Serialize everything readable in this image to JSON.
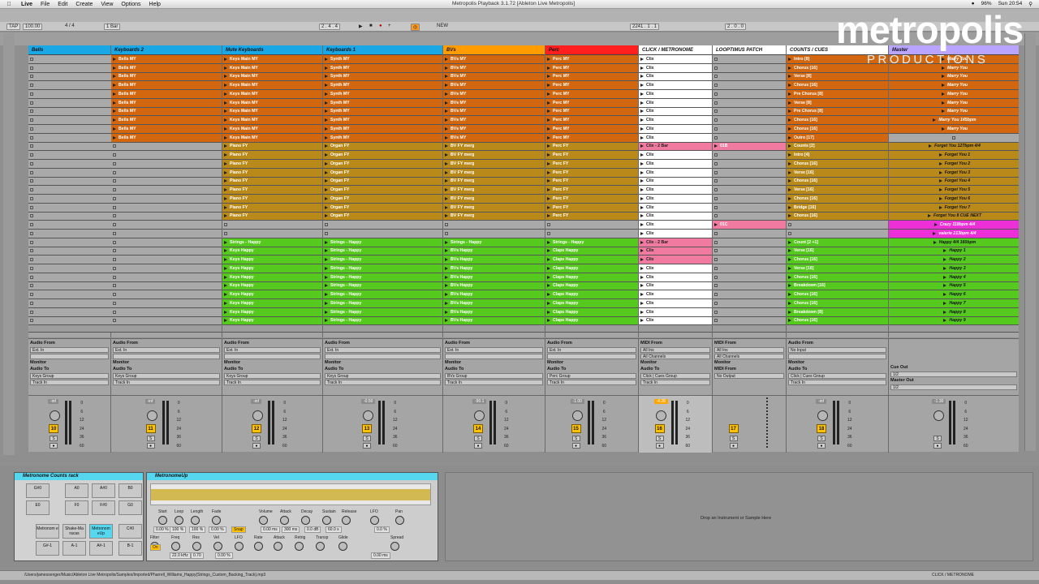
{
  "menubar": {
    "apple": "",
    "items": [
      "Live",
      "File",
      "Edit",
      "Create",
      "View",
      "Options",
      "Help"
    ],
    "title": "Metropolis Playback 3.1.72 [Ableton Live Metropolis]",
    "battery": "96%",
    "clock": "Sun 20:54"
  },
  "transport": {
    "tap": "TAP",
    "tempo": "100.00",
    "sig": "4 / 4",
    "quant": "1 Bar",
    "pos": "2 . 4 . 4",
    "new": "NEW",
    "pos2": "2241 . 1 . 1",
    "end": "2 . 0 . 0"
  },
  "logo": {
    "line1": "metropolis",
    "line2": "PRODUCTIONS"
  },
  "tracks": [
    {
      "name": "Bells",
      "color": "#1aa7e6"
    },
    {
      "name": "Keyboards 2",
      "color": "#1aa7e6"
    },
    {
      "name": "Mute Keyboards",
      "color": "#1aa7e6"
    },
    {
      "name": "Keyboards 1",
      "color": "#1aa7e6"
    },
    {
      "name": "BVs",
      "color": "#ff9d00"
    },
    {
      "name": "Perc",
      "color": "#ff1f1f"
    },
    {
      "name": "CLICK / METRONOME",
      "color": "#ffffff"
    },
    {
      "name": "LOOPTIMUS PATCH",
      "color": "#ffffff"
    },
    {
      "name": "COUNTS / CUES",
      "color": "#ffffff"
    },
    {
      "name": "Master",
      "color": "#b9a5ff"
    }
  ],
  "clips": {
    "bells": [
      "Bells MY",
      "Bells MY",
      "Bells MY",
      "Bells MY",
      "Bells MY",
      "Bells MY",
      "Bells MY",
      "Bells MY",
      "Bells MY",
      "Bells MY"
    ],
    "keys": [
      "Keys Main MY",
      "Keys Main MY",
      "Keys Main MY",
      "Keys Main MY",
      "Keys Main MY",
      "Keys Main MY",
      "Keys Main MY",
      "Keys Main MY",
      "Keys Main MY",
      "Keys Main MY"
    ],
    "piano": [
      "Piano FY",
      "Piano FY",
      "Piano FY",
      "Piano FY",
      "Piano FY",
      "Piano FY",
      "Piano FY",
      "Piano FY",
      "Piano FY"
    ],
    "synth": [
      "Synth MY",
      "Synth MY",
      "Synth MY",
      "Synth MY",
      "Synth MY",
      "Synth MY",
      "Synth MY",
      "Synth MY",
      "Synth MY",
      "Synth MY"
    ],
    "organ": [
      "Organ FY",
      "Organ FY",
      "Organ FY",
      "Organ FY",
      "Organ FY",
      "Organ FY",
      "Organ FY",
      "Organ FY",
      "Organ FY"
    ],
    "bvs": [
      "BVs MY",
      "BVs MY",
      "BVs MY",
      "BVs MY",
      "BVs MY",
      "BVs MY",
      "BVs MY",
      "BVs MY",
      "BVs MY",
      "BVs MY"
    ],
    "bvfy": [
      "BV FY merg",
      "BV FY merg",
      "BV FY merg",
      "BV FY merg",
      "BV FY merg",
      "BV FY merg",
      "BV FY merg",
      "BV FY merg",
      "BV FY merg"
    ],
    "perc": [
      "Perc MY",
      "Perc MY",
      "Perc MY",
      "Perc MY",
      "Perc MY",
      "Perc MY",
      "Perc MY",
      "Perc MY",
      "Perc MY",
      "Perc MY"
    ],
    "percfy": [
      "Perc FY",
      "Perc FY",
      "Perc FY",
      "Perc FY",
      "Perc FY",
      "Perc FY",
      "Perc FY",
      "Perc FY",
      "Perc FY"
    ],
    "happy_mute": [
      "Strings - Happy",
      "Keys Happy",
      "Keys Happy",
      "Keys Happy",
      "Keys Happy",
      "Keys Happy",
      "Keys Happy",
      "Keys Happy",
      "Keys Happy",
      "Keys Happy"
    ],
    "happy_k1": [
      "Strings - Happy",
      "Strings - Happy",
      "Strings - Happy",
      "Strings - Happy",
      "Strings - Happy",
      "Strings - Happy",
      "Strings - Happy",
      "Strings - Happy",
      "Strings - Happy",
      "Strings - Happy"
    ],
    "happy_bv": [
      "Strings - Happy",
      "BVs Happy",
      "BVs Happy",
      "BVs Happy",
      "BVs Happy",
      "BVs Happy",
      "BVs Happy",
      "BVs Happy",
      "BVs Happy",
      "BVs Happy"
    ],
    "happy_perc": [
      "Strings - Happy",
      "Claps Happy",
      "Claps Happy",
      "Claps Happy",
      "Claps Happy",
      "Claps Happy",
      "Claps Happy",
      "Claps Happy",
      "Claps Happy",
      "Claps Happy"
    ],
    "click1": [
      "Clix",
      "Clix",
      "Clix",
      "Clix",
      "Clix",
      "Clix",
      "Clix",
      "Clix",
      "Clix",
      "Clix"
    ],
    "click2": [
      "Clix - 2 Bar",
      "Clix",
      "Clix",
      "Clix",
      "Clix",
      "Clix",
      "Clix",
      "Clix",
      "Clix"
    ],
    "click3": [
      "Clix",
      "Clix",
      "Clix - 2 Bar",
      "Clix",
      "Clix",
      "Clix",
      "Clix",
      "Clix",
      "Clix",
      "Clix",
      "Clix",
      "Clix",
      "Clix"
    ],
    "loop": [
      "01B",
      "01C",
      "01D",
      "01E"
    ],
    "counts1": [
      "Intro [8]",
      "Chorus [16]",
      "Verse [8]",
      "Chorus [16]",
      "Pre Chorus [8]",
      "Verse [8]",
      "Pre Chorus [8]",
      "Chorus [16]",
      "Chorus [16]",
      "Outro [17]"
    ],
    "counts2": [
      "Counts [2]",
      "Intro [4]",
      "Chorus [16]",
      "Verse [16]",
      "Chorus [16]",
      "Verse [16]",
      "Chorus [16]",
      "Bridge [16]",
      "Chorus [16]"
    ],
    "counts3": [
      "Count [2 +1]",
      "Verse [16]",
      "Chorus [16]",
      "Verse [16]",
      "Chorus [16]",
      "Breakdown [16]",
      "Chorus [16]",
      "Chorus [16]",
      "Breakdown [8]",
      "Chorus [16]"
    ],
    "master1": [
      "Marry You",
      "Marry You",
      "Marry You",
      "Marry You",
      "Marry You",
      "Marry You",
      "Marry You",
      "Marry You 145bpm",
      "Marry You"
    ],
    "master2": [
      "Forget You 127bpm 4/4",
      "Forget You 1",
      "Forget You 2",
      "Forget You 3",
      "Forget You 4",
      "Forget You 5",
      "Forget You 6",
      "Forget You 7",
      "Forget You 8 CUE NEXT"
    ],
    "master3": [
      "Crazy 118bpm 4/4",
      "valerie 213bpm 4/4"
    ],
    "master4": [
      "Happy 4/4 160bpm",
      "Happy 1",
      "Happy 2",
      "Happy 3",
      "Happy 4",
      "Happy 5",
      "Happy 6",
      "Happy 7",
      "Happy 8",
      "Happy 9"
    ]
  },
  "io": {
    "audio_from": "Audio From",
    "ext_in": "Ext. In",
    "monitor": "Monitor",
    "in": "In",
    "auto": "Auto",
    "off": "Off",
    "audio_to": "Audio To",
    "keys_group": "Keys Group",
    "track_in": "Track In",
    "bvs_group": "BVs Group",
    "perc_group": "Perc Group",
    "midi_from": "MIDI From",
    "all_ins": "All Ins",
    "all_channels": "All Channels",
    "click_cues": "Click | Cues Group",
    "no_output": "No Output",
    "no_input": "No Input",
    "cue_out": "Cue Out",
    "cue_val": "1/2",
    "master_out": "Master Out",
    "master_val": "1/2"
  },
  "mixer": {
    "vols": [
      "-inf",
      "-inf",
      "-inf",
      "-0.50",
      "-90.1",
      "-1.00",
      "-4.28",
      "",
      "-inf",
      "-1.30"
    ],
    "nums": [
      "10",
      "11",
      "12",
      "13",
      "14",
      "15",
      "16",
      "17",
      "18"
    ],
    "scale": [
      "0",
      "6",
      "12",
      "24",
      "36",
      "60"
    ]
  },
  "rack": {
    "title": "Metronome Counts rack",
    "pads": [
      "G#0",
      "A0",
      "A#0",
      "B0",
      "E0",
      "F0",
      "F#0",
      "G0",
      "Metronom e",
      "Shake-Ma racas",
      "Metronom eUp",
      "C#0",
      "G#-1",
      "A-1",
      "A#-1",
      "B-1"
    ]
  },
  "simpler": {
    "title": "MetronomeUp",
    "params": [
      "Start",
      "Loop",
      "Length",
      "Fade",
      "Volume",
      "Attack",
      "Decay",
      "Sustain",
      "Release",
      "LFO",
      "Pan",
      "Filter",
      "Freq",
      "Res",
      "Vel",
      "LFO",
      "Rate",
      "Attack",
      "Retrig",
      "Transp",
      "Glide",
      "Spread"
    ],
    "vals": [
      "0.00 %",
      "100 %",
      "100 %",
      "0.00 %",
      "0.00 ms",
      "300 ms",
      "0.0 dB",
      "60.0 s",
      "0.0 %",
      "22.0 kHz",
      "0.70",
      "0.00 %",
      "0.00 ms"
    ],
    "filter_on": "On",
    "snap": "Snap",
    "volume": "Volume"
  },
  "dropzone": "Drop an Instrument or Sample Here",
  "status": {
    "path": "/Users/jamessenger/Music/Ableton Live Metropolis/Samples/Imported/Pharrell_Williams_Happy(Strings_Custom_Backing_Track).mp3",
    "right": "CLICK / METRONOME"
  }
}
